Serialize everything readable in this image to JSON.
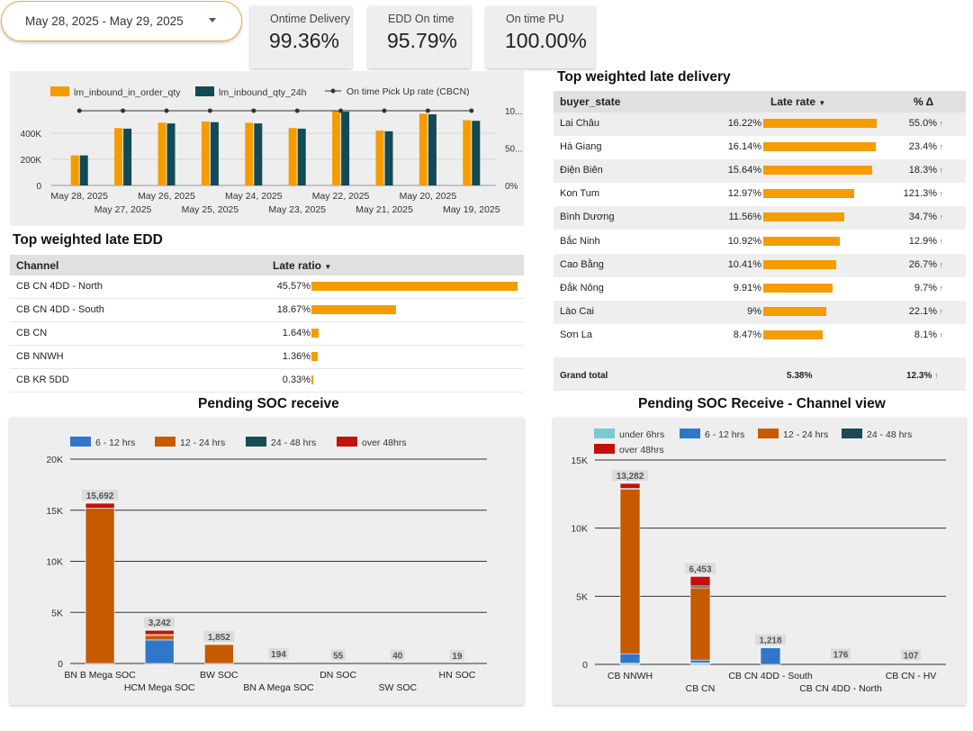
{
  "date_range": {
    "label": "May 28, 2025 - May 29, 2025"
  },
  "kpis": [
    {
      "label": "Ontime Delivery",
      "value": "99.36%"
    },
    {
      "label": "EDD On time",
      "value": "95.79%"
    },
    {
      "label": "On time PU",
      "value": "100.00%"
    }
  ],
  "colors": {
    "orange": "#f59c00",
    "teal": "#124a55",
    "blue": "#3177c8",
    "rust": "#c55a00",
    "dark_teal": "#1a4a52",
    "red": "#c2110b",
    "light_teal": "#7ec8d3"
  },
  "chart_data": [
    {
      "id": "inbound_chart",
      "type": "bar",
      "categories": [
        "May 28, 2025",
        "May 27, 2025",
        "May 26, 2025",
        "May 25, 2025",
        "May 24, 2025",
        "May 23, 2025",
        "May 22, 2025",
        "May 21, 2025",
        "May 20, 2025",
        "May 19, 2025"
      ],
      "series": [
        {
          "name": "lm_inbound_in_order_qty",
          "values": [
            230000,
            440000,
            480000,
            490000,
            480000,
            440000,
            570000,
            420000,
            550000,
            500000
          ]
        },
        {
          "name": "lm_inbound_qty_24h",
          "values": [
            230000,
            435000,
            475000,
            485000,
            475000,
            435000,
            565000,
            415000,
            545000,
            495000
          ]
        },
        {
          "name": "On time Pick Up rate (CBCN)",
          "type": "line",
          "axis": "right",
          "values": [
            100,
            100,
            100,
            100,
            100,
            100,
            100,
            100,
            100,
            100
          ]
        }
      ],
      "y_ticks": [
        "0",
        "200K",
        "400K"
      ],
      "y_right_ticks": [
        "0%",
        "50...",
        "10..."
      ],
      "ylim": [
        0,
        600000
      ],
      "y_right_lim": [
        0,
        100
      ],
      "legend_position": "top"
    },
    {
      "id": "pending_soc",
      "type": "bar",
      "title": "Pending SOC receive",
      "categories": [
        "BN B Mega SOC",
        "HCM Mega SOC",
        "BW SOC",
        "BN A Mega SOC",
        "DN SOC",
        "SW SOC",
        "HN SOC"
      ],
      "series": [
        {
          "name": "6 - 12 hrs",
          "values": [
            0,
            2300,
            0,
            0,
            0,
            0,
            0
          ]
        },
        {
          "name": "12 - 24 hrs",
          "values": [
            15200,
            450,
            1852,
            0,
            0,
            0,
            0
          ]
        },
        {
          "name": "24 - 48 hrs",
          "values": [
            0,
            80,
            0,
            0,
            0,
            0,
            0
          ]
        },
        {
          "name": "over 48hrs",
          "values": [
            480,
            412,
            0,
            0,
            0,
            0,
            0
          ]
        }
      ],
      "totals": [
        "15,692",
        "3,242",
        "1,852",
        "194",
        "55",
        "40",
        "19"
      ],
      "total_values": [
        15692,
        3242,
        1852,
        194,
        55,
        40,
        19
      ],
      "y_ticks": [
        "0",
        "5K",
        "10K",
        "15K",
        "20K"
      ],
      "ylim": [
        0,
        20000
      ],
      "legend_position": "top"
    },
    {
      "id": "pending_soc_channel",
      "type": "bar",
      "title": "Pending SOC Receive - Channel view",
      "categories": [
        "CB NNWH",
        "CB CN",
        "CB CN 4DD - South",
        "CB CN 4DD - North",
        "CB CN - HV"
      ],
      "series": [
        {
          "name": "under 6hrs",
          "values": [
            80,
            120,
            0,
            0,
            0
          ]
        },
        {
          "name": "6 - 12 hrs",
          "values": [
            700,
            200,
            1218,
            0,
            0
          ]
        },
        {
          "name": "12 - 24 hrs",
          "values": [
            12100,
            5300,
            0,
            0,
            0
          ]
        },
        {
          "name": "24 - 48 hrs",
          "values": [
            50,
            133,
            0,
            0,
            0
          ]
        },
        {
          "name": "over 48hrs",
          "values": [
            352,
            700,
            0,
            0,
            0
          ]
        }
      ],
      "totals": [
        "13,282",
        "6,453",
        "1,218",
        "176",
        "107"
      ],
      "total_values": [
        13282,
        6453,
        1218,
        176,
        107
      ],
      "y_ticks": [
        "0",
        "5K",
        "10K",
        "15K"
      ],
      "ylim": [
        0,
        15000
      ],
      "legend_position": "top-left"
    }
  ],
  "late_edd": {
    "title": "Top weighted late EDD",
    "headers": {
      "channel": "Channel",
      "late_ratio": "Late ratio"
    },
    "rows": [
      {
        "channel": "CB CN 4DD - North",
        "ratio": "45.57%",
        "value": 45.57
      },
      {
        "channel": "CB CN 4DD - South",
        "ratio": "18.67%",
        "value": 18.67
      },
      {
        "channel": "CB CN",
        "ratio": "1.64%",
        "value": 1.64
      },
      {
        "channel": "CB NNWH",
        "ratio": "1.36%",
        "value": 1.36
      },
      {
        "channel": "CB KR 5DD",
        "ratio": "0.33%",
        "value": 0.33
      }
    ]
  },
  "late_delivery": {
    "title": "Top weighted late delivery",
    "headers": {
      "state": "buyer_state",
      "rate": "Late rate",
      "delta": "% Δ"
    },
    "rows": [
      {
        "state": "Lai Châu",
        "rate": "16.22%",
        "value": 16.22,
        "delta": "55.0%"
      },
      {
        "state": "Hà Giang",
        "rate": "16.14%",
        "value": 16.14,
        "delta": "23.4%"
      },
      {
        "state": "Điện Biên",
        "rate": "15.64%",
        "value": 15.64,
        "delta": "18.3%"
      },
      {
        "state": "Kon Tum",
        "rate": "12.97%",
        "value": 12.97,
        "delta": "121.3%"
      },
      {
        "state": "Bình Dương",
        "rate": "11.56%",
        "value": 11.56,
        "delta": "34.7%"
      },
      {
        "state": "Bắc Ninh",
        "rate": "10.92%",
        "value": 10.92,
        "delta": "12.9%"
      },
      {
        "state": "Cao Bằng",
        "rate": "10.41%",
        "value": 10.41,
        "delta": "26.7%"
      },
      {
        "state": "Đắk Nông",
        "rate": "9.91%",
        "value": 9.91,
        "delta": "9.7%"
      },
      {
        "state": "Lào Cai",
        "rate": "9%",
        "value": 9.0,
        "delta": "22.1%"
      },
      {
        "state": "Sơn La",
        "rate": "8.47%",
        "value": 8.47,
        "delta": "8.1%"
      }
    ],
    "grand_total": {
      "label": "Grand total",
      "rate": "5.38%",
      "delta": "12.3%"
    }
  }
}
